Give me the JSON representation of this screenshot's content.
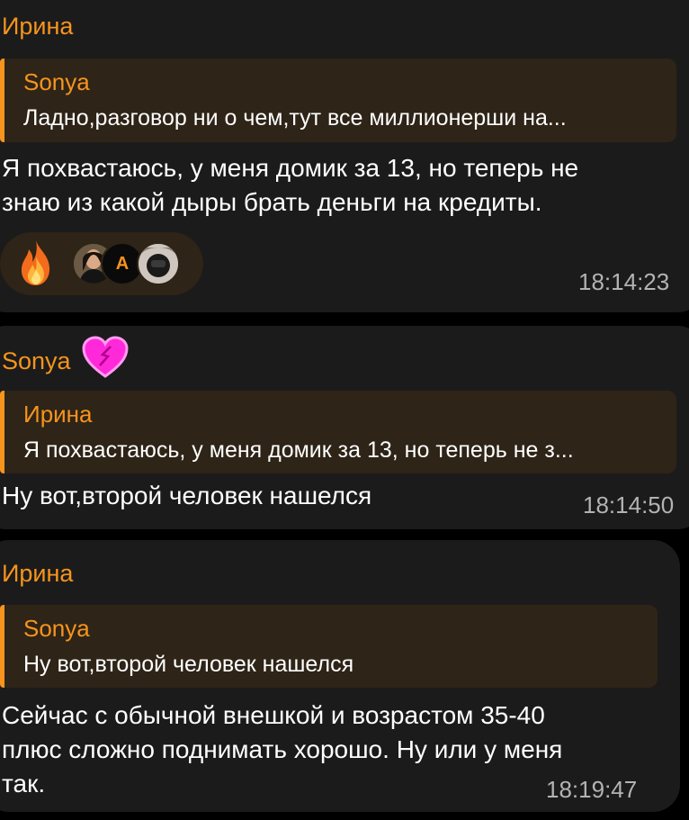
{
  "messages": [
    {
      "sender": "Ирина",
      "reply": {
        "author": "Sonya",
        "text": "Ладно,разговор ни о чем,тут все миллионерши на..."
      },
      "lines": [
        "Я похвастаюсь, у меня домик за 13, но теперь не",
        "знаю из какой дыры брать деньги на кредиты."
      ],
      "reactions": {
        "emoji": "fire-emoji",
        "avatars": [
          "avatar-woman-photo",
          "A",
          "avatar-photo"
        ]
      },
      "time": "18:14:23"
    },
    {
      "sender": "Sonya",
      "sender_badge": "pink-heart-icon",
      "reply": {
        "author": "Ирина",
        "text": "Я похвастаюсь, у меня домик за 13, но теперь не з..."
      },
      "lines": [
        "Ну вот,второй человек нашелся"
      ],
      "time": "18:14:50"
    },
    {
      "sender": "Ирина",
      "reply": {
        "author": "Sonya",
        "text": "Ну вот,второй человек нашелся"
      },
      "lines": [
        "Сейчас с обычной внешкой и  возрастом 35-40",
        "плюс сложно поднимать хорошо. Ну или у меня",
        "так."
      ],
      "time": "18:19:47"
    }
  ],
  "colors": {
    "background": "#000000",
    "bubble": "#1b1b1b",
    "accent": "#f7941d",
    "reply_bg": "#2e2417",
    "text": "#ffffff",
    "time": "#b3b3b3"
  }
}
